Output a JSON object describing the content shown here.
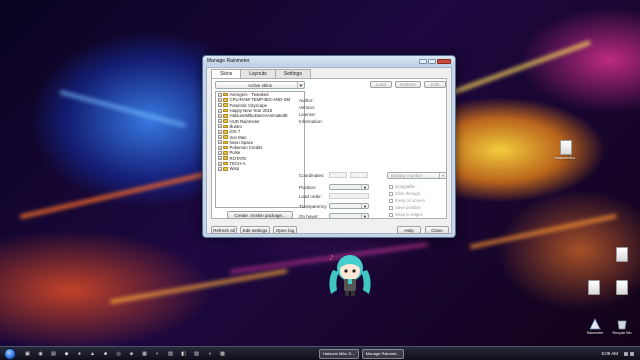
{
  "window": {
    "title": "Manage Rainmeter",
    "tabs": [
      "Skins",
      "Layouts",
      "Settings"
    ],
    "active_tab": "Skins"
  },
  "skins_panel": {
    "active_skins_label": "Active skins",
    "tree_items": [
      {
        "label": "Avengers - Tweaked",
        "expanded": true
      },
      {
        "label": "CPU-RAM-TEMP-BIG-AND-SM",
        "expanded": true
      },
      {
        "label": "Futuristic Cityscape",
        "expanded": true
      },
      {
        "label": "Happy New Year 2015",
        "expanded": true
      },
      {
        "label": "HatsuneMikuDanceAnimatedE",
        "expanded": true
      },
      {
        "label": "HUD Rainmeter",
        "expanded": true
      },
      {
        "label": "illustro",
        "expanded": true
      },
      {
        "label": "iOS 7",
        "expanded": true
      },
      {
        "label": "Iron Man",
        "expanded": true
      },
      {
        "label": "Neon Space",
        "expanded": true
      },
      {
        "label": "Pokemon Credits",
        "expanded": true
      },
      {
        "label": "Pulse",
        "expanded": true
      },
      {
        "label": "ROTATE",
        "expanded": true
      },
      {
        "label": "TECH-A",
        "expanded": true
      },
      {
        "label": "Wisp",
        "expanded": true
      }
    ],
    "create_button": "Create .rmskin package..."
  },
  "details": {
    "skin_name": "---",
    "load_button": "Load",
    "refresh_button": "Refresh",
    "edit_button": "Edit",
    "meta_labels": [
      "Author:",
      "Version:",
      "License:",
      "Information:"
    ],
    "coordinates_label": "Coordinates:",
    "display_monitor": "Display monitor",
    "position_label": "Position:",
    "load_order_label": "Load order:",
    "transparency_label": "Transparency:",
    "on_hover_label": "On hover:",
    "checkboxes": [
      "Draggable",
      "Click through",
      "Keep on screen",
      "Save position",
      "Snap to edges"
    ]
  },
  "footer": {
    "refresh_all": "Refresh all",
    "edit_settings": "Edit settings",
    "open_log": "Open log",
    "help": "Help",
    "close": "Close"
  },
  "desktop_icons": [
    "Hatsunemiku...",
    "Rainmeter",
    "Recycle Bin"
  ],
  "taskbar": {
    "windows": [
      "Hatsune Miku D...",
      "Manage Rainmet..."
    ],
    "clock": "5:08 AM"
  }
}
